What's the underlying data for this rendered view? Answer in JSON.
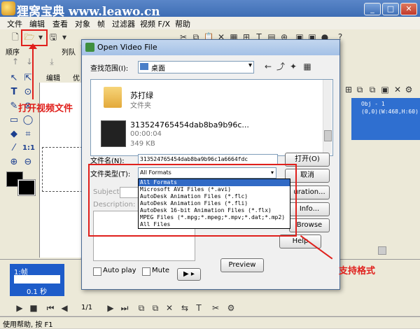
{
  "app": {
    "title": "狸窝宝典 www.leawo.cn",
    "menu": [
      "文件",
      "编辑",
      "查看",
      "对象",
      "帧",
      "过滤器",
      "视频 F/X",
      "帮助"
    ]
  },
  "panels": {
    "order_label": "顺序",
    "list_label": "列队",
    "edit_tab": "编辑",
    "tab_partial": "优"
  },
  "object_list": {
    "line1": "Obj - 1",
    "line2": "(0,0)(W:468,H:60)"
  },
  "timeline": {
    "frame_label": "1:帧",
    "frame_time": "0.1 秒",
    "page_counter": "1/1"
  },
  "status": {
    "text": "使用帮助, 按 F1"
  },
  "dialog": {
    "title": "Open Video File",
    "look_in_label": "查找范围(I):",
    "look_in_value": "桌面",
    "files": [
      {
        "name": "苏打绿",
        "meta1": "文件夹",
        "meta2": ""
      },
      {
        "name": "313524765454dab8ba9b96c...",
        "meta1": "00:00:04",
        "meta2": "349 KB"
      }
    ],
    "filename_label": "文件名(N):",
    "filename_value": "313524765454dab8ba9b96c1a6664fdc",
    "filetype_label": "文件类型(T):",
    "filetype_value": "All Formats",
    "filetype_options": [
      "All Formats",
      "Microsoft AVI Files (*.avi)",
      "AutoDesk Animation Files (*.flc)",
      "AutoDesk Animation Files (*.fli)",
      "AutoDesk 16-bit Animation Files (*.flx)",
      "MPEG Files (*.mpg;*.mpeg;*.mpv;*.dat;*.mp2)",
      "All Files"
    ],
    "open_button": "打开(O)",
    "cancel_button": "取消",
    "duration_button": "uration...",
    "info_button": "Info...",
    "browse_button": "Browse",
    "help_button": "Help",
    "subject_label": "Subject:",
    "description_label": "Description:",
    "autoplay_label": "Auto play",
    "mute_label": "Mute",
    "preview_button": "Preview",
    "play_button": "▶ ▸"
  },
  "annotations": {
    "open_file": "打开视频文件",
    "formats": "支持格式"
  },
  "colors": {
    "annotation_red": "#e0201c",
    "selection_blue": "#316ac5",
    "title_blue": "#3d6db4"
  }
}
